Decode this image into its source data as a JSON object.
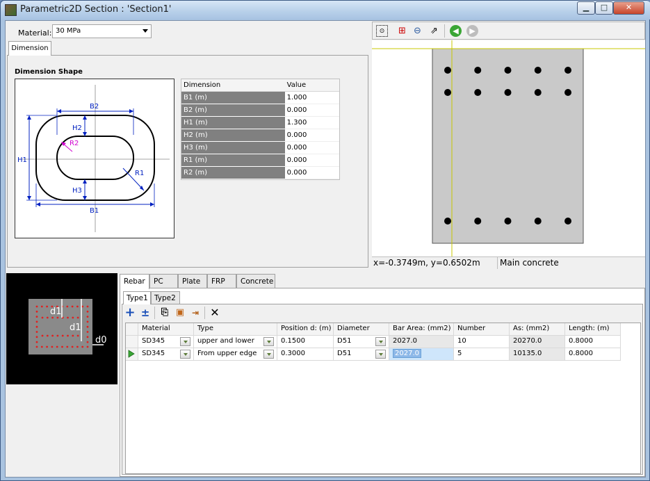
{
  "window": {
    "title": "Parametric2D Section : 'Section1'",
    "controls": [
      "minimize",
      "maximize",
      "close"
    ]
  },
  "material": {
    "label": "Material:",
    "value": "30 MPa"
  },
  "dimension_tab": "Dimension",
  "dimension_shape": {
    "title": "Dimension Shape",
    "drawing_labels": {
      "b1": "B1",
      "b2": "B2",
      "h1": "H1",
      "h2": "H2",
      "h3": "H3",
      "r1": "R1",
      "r2": "R2"
    }
  },
  "dimension_table": {
    "headers": [
      "Dimension",
      "Value"
    ],
    "rows": [
      {
        "name": "B1 (m)",
        "value": "1.000"
      },
      {
        "name": "B2 (m)",
        "value": "0.000"
      },
      {
        "name": "H1 (m)",
        "value": "1.300"
      },
      {
        "name": "H2 (m)",
        "value": "0.000"
      },
      {
        "name": "H3 (m)",
        "value": "0.000"
      },
      {
        "name": "R1 (m)",
        "value": "0.000"
      },
      {
        "name": "R2 (m)",
        "value": "0.000"
      }
    ]
  },
  "preview": {
    "toolbar_icons": [
      "select-icon",
      "zoom-window-icon",
      "zoom-out-icon",
      "zoom-extent-icon",
      "back-icon",
      "forward-icon"
    ],
    "status_coords": "x=-0.3749m, y=0.6502m",
    "status_layer": "Main concrete",
    "section": {
      "width_m": 1.0,
      "height_m": 1.3,
      "top_rows": 2,
      "bottom_rows": 1,
      "bars_per_row": 5
    }
  },
  "thumbnail_labels": {
    "d1_top": "d1",
    "d1_mid": "d1",
    "d0": "d0"
  },
  "bottom_tabs": [
    "Rebar",
    "PC",
    "Plate",
    "FRP",
    "Concrete"
  ],
  "sub_tabs": [
    "Type1",
    "Type2"
  ],
  "rebar_toolbar_icons": [
    "add-row-icon",
    "insert-row-icon",
    "copy-icon",
    "paste-icon",
    "import-icon",
    "delete-icon"
  ],
  "rebar_table": {
    "headers": [
      "Material",
      "Type",
      "Position d: (m)",
      "Diameter",
      "Bar Area: (mm2)",
      "Number",
      "As: (mm2)",
      "Length: (m)"
    ],
    "rows": [
      {
        "material": "SD345",
        "type": "upper and lower",
        "position": "0.1500",
        "diameter": "D51",
        "bar_area": "2027.0",
        "number": "10",
        "as": "20270.0",
        "length": "0.8000",
        "current": false
      },
      {
        "material": "SD345",
        "type": "From upper edge",
        "position": "0.3000",
        "diameter": "D51",
        "bar_area": "2027.0",
        "number": "5",
        "as": "10135.0",
        "length": "0.8000",
        "current": true
      }
    ]
  }
}
